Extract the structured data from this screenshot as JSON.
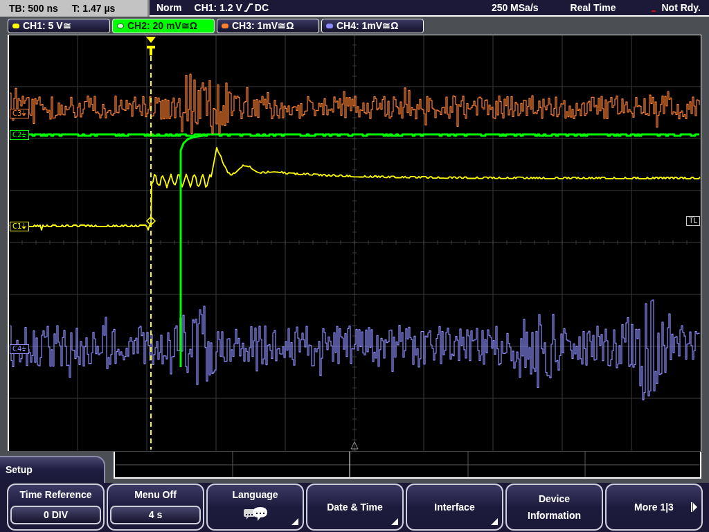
{
  "status_bar": {
    "timebase": "TB: 500 ns",
    "trigger_time": "T: 1.47 µs",
    "trigger_mode": "Norm",
    "trigger_source": "CH1: 1.2 V",
    "slope": {
      "kind": "rising"
    },
    "coupling": "DC",
    "sample_rate": "250 MSa/s",
    "acquisition": "Real Time",
    "state": "Not Rdy."
  },
  "channels": [
    {
      "label": "CH1: 5 V≅",
      "color": "#ffff00",
      "selected": false
    },
    {
      "label": "CH2: 20 mV≅Ω",
      "color": "#00ff00",
      "selected": true
    },
    {
      "label": "CH3: 1mV≅Ω",
      "color": "#ff8030",
      "selected": false
    },
    {
      "label": "CH4: 1mV≅Ω",
      "color": "#8c8cff",
      "selected": false
    }
  ],
  "display": {
    "markers": [
      {
        "label": "C3⏚",
        "color": "#ff8030"
      },
      {
        "label": "C2⏚",
        "color": "#00ff00"
      },
      {
        "label": "C1⏚",
        "color": "#ffff00"
      },
      {
        "label": "C4⏚",
        "color": "#8c8cff"
      }
    ],
    "trigger_level_marker": "TL"
  },
  "menu": {
    "title": "Setup",
    "softkeys": [
      {
        "kind": "value",
        "label": "Time Reference",
        "value": "0 DIV"
      },
      {
        "kind": "value",
        "label": "Menu Off",
        "value": "4 s"
      },
      {
        "kind": "icon",
        "label": "Language",
        "submenu": true
      },
      {
        "kind": "text",
        "label": "Date & Time",
        "submenu": true
      },
      {
        "kind": "text",
        "label": "Interface",
        "submenu": true
      },
      {
        "kind": "text",
        "label": "Device Information",
        "submenu": false
      },
      {
        "kind": "next",
        "label": "More 1|3"
      }
    ]
  }
}
